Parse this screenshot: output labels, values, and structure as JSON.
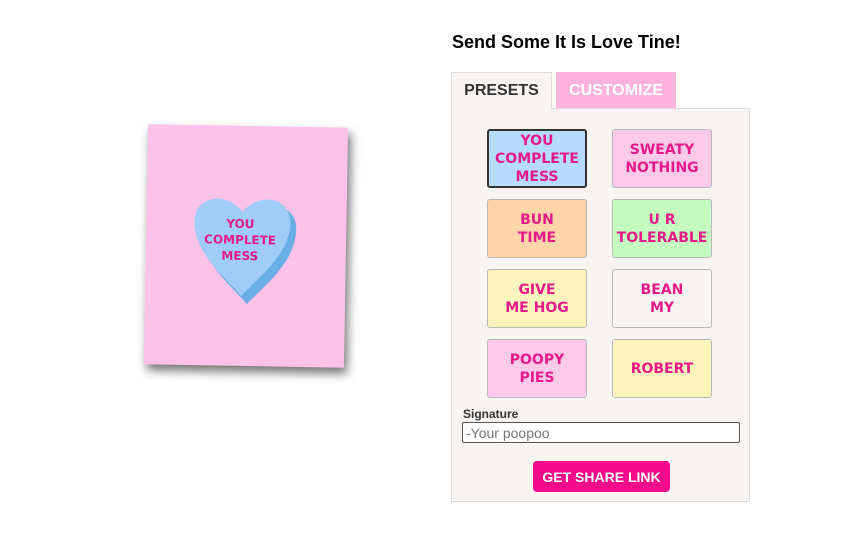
{
  "title": "Send Some It Is Love Tine!",
  "tabs": {
    "presets": "PRESETS",
    "customize": "CUSTOMIZE"
  },
  "card": {
    "background_color": "#fcc2e8",
    "heart_color": "#9fcdf8",
    "text_color": "#e5198a",
    "heart_lines": [
      "YOU",
      "COMPLETE",
      "MESS"
    ]
  },
  "presets": [
    {
      "lines": [
        "YOU",
        "COMPLETE",
        "MESS"
      ],
      "color": "#b7dcfb",
      "selected": true
    },
    {
      "lines": [
        "SWEATY",
        "NOTHING"
      ],
      "color": "#fcc9e8",
      "selected": false
    },
    {
      "lines": [
        "BUN",
        "TIME"
      ],
      "color": "#fed5a8",
      "selected": false
    },
    {
      "lines": [
        "U R",
        "TOLERABLE"
      ],
      "color": "#c4fcc0",
      "selected": false
    },
    {
      "lines": [
        "GIVE",
        "ME HOG"
      ],
      "color": "#fdf3bd",
      "selected": false
    },
    {
      "lines": [
        "BEAN",
        "MY"
      ],
      "color": "#f7f4f2",
      "selected": false
    },
    {
      "lines": [
        "POOPY",
        "PIES"
      ],
      "color": "#fcc9e8",
      "selected": false
    },
    {
      "lines": [
        "ROBERT"
      ],
      "color": "#fdf3bd",
      "selected": false
    }
  ],
  "signature": {
    "label": "Signature",
    "placeholder": "-Your poopoo",
    "value": ""
  },
  "share_button": "GET SHARE LINK",
  "colors": {
    "accent": "#f50a8c",
    "customize_tab": "#fbb3dd",
    "panel_bg": "#f7f4f2"
  }
}
